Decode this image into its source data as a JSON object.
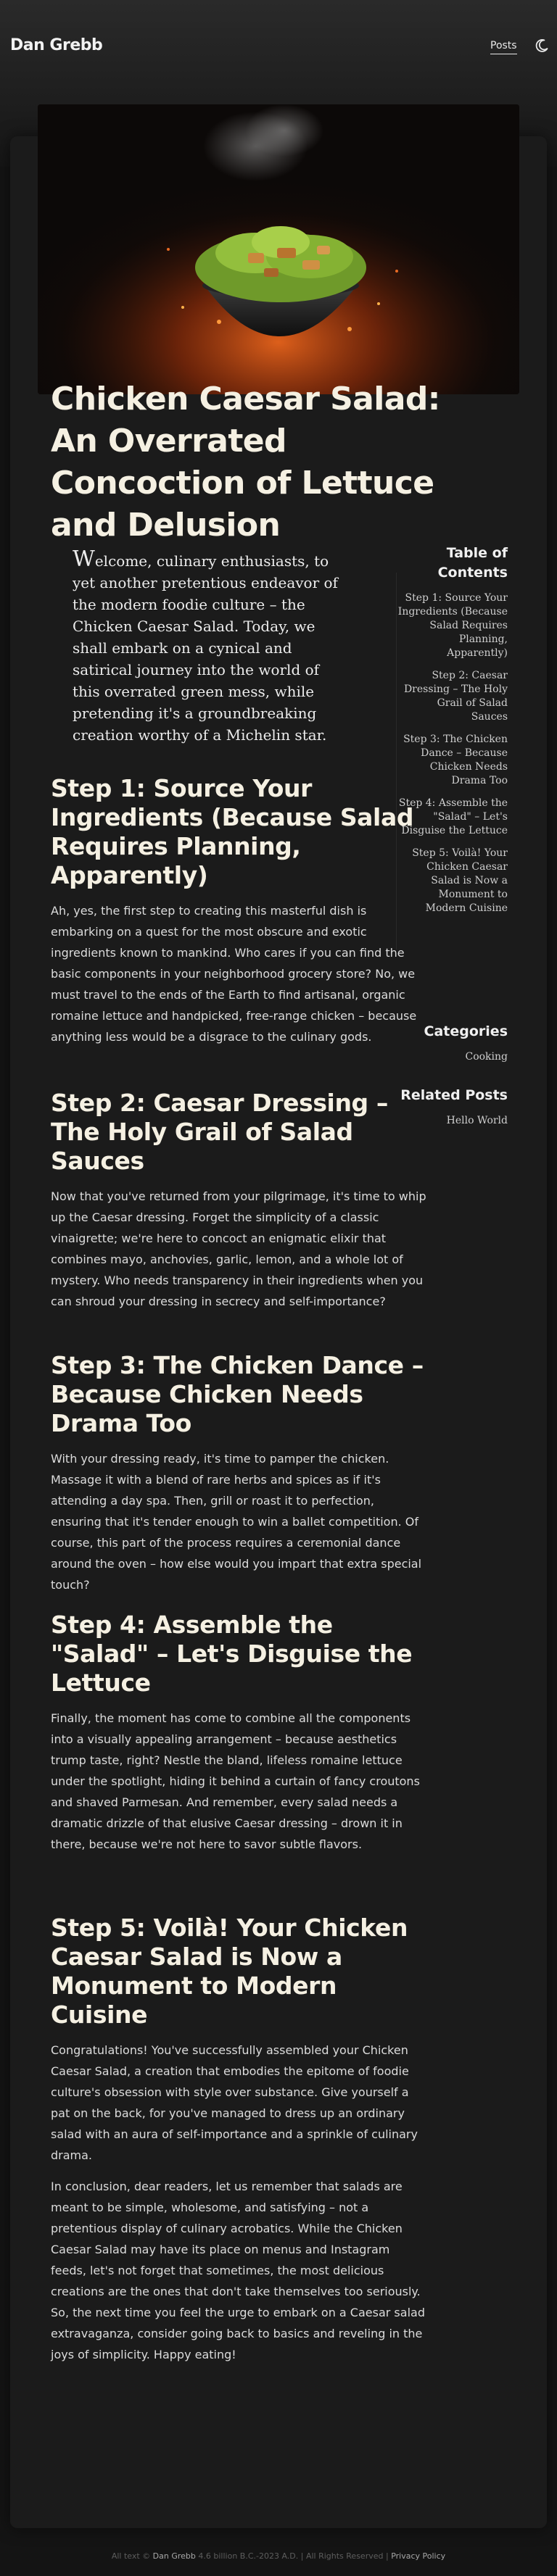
{
  "header": {
    "brand": "Dan Grebb",
    "nav_posts": "Posts",
    "theme_icon": "moon-icon"
  },
  "post": {
    "hero_alt": "Chicken Caesar salad in a dark bowl with flames",
    "title": "Chicken Caesar Salad: An Overrated Concoction of Lettuce and Delusion",
    "intro": "Welcome, culinary enthusiasts, to yet another pretentious endeavor of the modern foodie culture – the Chicken Caesar Salad. Today, we shall embark on a cynical and satirical journey into the world of this overrated green mess, while pretending it's a groundbreaking creation worthy of a Michelin star.",
    "sections": [
      {
        "heading": "Step 1: Source Your Ingredients (Because Salad Requires Planning, Apparently)",
        "paragraphs": [
          "Ah, yes, the first step to creating this masterful dish is embarking on a quest for the most obscure and exotic ingredients known to mankind. Who cares if you can find the basic components in your neighborhood grocery store? No, we must travel to the ends of the Earth to find artisanal, organic romaine lettuce and handpicked, free-range chicken – because anything less would be a disgrace to the culinary gods."
        ]
      },
      {
        "heading": "Step 2: Caesar Dressing – The Holy Grail of Salad Sauces",
        "paragraphs": [
          "Now that you've returned from your pilgrimage, it's time to whip up the Caesar dressing. Forget the simplicity of a classic vinaigrette; we're here to concoct an enigmatic elixir that combines mayo, anchovies, garlic, lemon, and a whole lot of mystery. Who needs transparency in their ingredients when you can shroud your dressing in secrecy and self-importance?"
        ]
      },
      {
        "heading": "Step 3: The Chicken Dance – Because Chicken Needs Drama Too",
        "paragraphs": [
          "With your dressing ready, it's time to pamper the chicken. Massage it with a blend of rare herbs and spices as if it's attending a day spa. Then, grill or roast it to perfection, ensuring that it's tender enough to win a ballet competition. Of course, this part of the process requires a ceremonial dance around the oven – how else would you impart that extra special touch?"
        ]
      },
      {
        "heading": "Step 4: Assemble the \"Salad\" – Let's Disguise the Lettuce",
        "paragraphs": [
          "Finally, the moment has come to combine all the components into a visually appealing arrangement – because aesthetics trump taste, right? Nestle the bland, lifeless romaine lettuce under the spotlight, hiding it behind a curtain of fancy croutons and shaved Parmesan. And remember, every salad needs a dramatic drizzle of that elusive Caesar dressing – drown it in there, because we're not here to savor subtle flavors."
        ]
      },
      {
        "heading": "Step 5: Voilà! Your Chicken Caesar Salad is Now a Monument to Modern Cuisine",
        "paragraphs": [
          "Congratulations! You've successfully assembled your Chicken Caesar Salad, a creation that embodies the epitome of foodie culture's obsession with style over substance. Give yourself a pat on the back, for you've managed to dress up an ordinary salad with an aura of self-importance and a sprinkle of culinary drama.",
          "In conclusion, dear readers, let us remember that salads are meant to be simple, wholesome, and satisfying – not a pretentious display of culinary acrobatics. While the Chicken Caesar Salad may have its place on menus and Instagram feeds, let's not forget that sometimes, the most delicious creations are the ones that don't take themselves too seriously. So, the next time you feel the urge to embark on a Caesar salad extravaganza, consider going back to basics and reveling in the joys of simplicity. Happy eating!"
        ]
      }
    ]
  },
  "sidebar": {
    "toc_heading": "Table of Contents",
    "toc_items": [
      "Step 1: Source Your Ingredients (Because Salad Requires Planning, Apparently)",
      "Step 2: Caesar Dressing – The Holy Grail of Salad Sauces",
      "Step 3: The Chicken Dance – Because Chicken Needs Drama Too",
      "Step 4: Assemble the \"Salad\" – Let's Disguise the Lettuce",
      "Step 5: Voilà! Your Chicken Caesar Salad is Now a Monument to Modern Cuisine"
    ],
    "categories_heading": "Categories",
    "categories": [
      "Cooking"
    ],
    "related_heading": "Related Posts",
    "related": [
      "Hello World"
    ]
  },
  "footer": {
    "prefix": "All text ©",
    "brand": "Dan Grebb",
    "rest": "4.6 billion B.C.-2023 A.D. | All Rights Reserved |",
    "privacy": "Privacy Policy"
  }
}
